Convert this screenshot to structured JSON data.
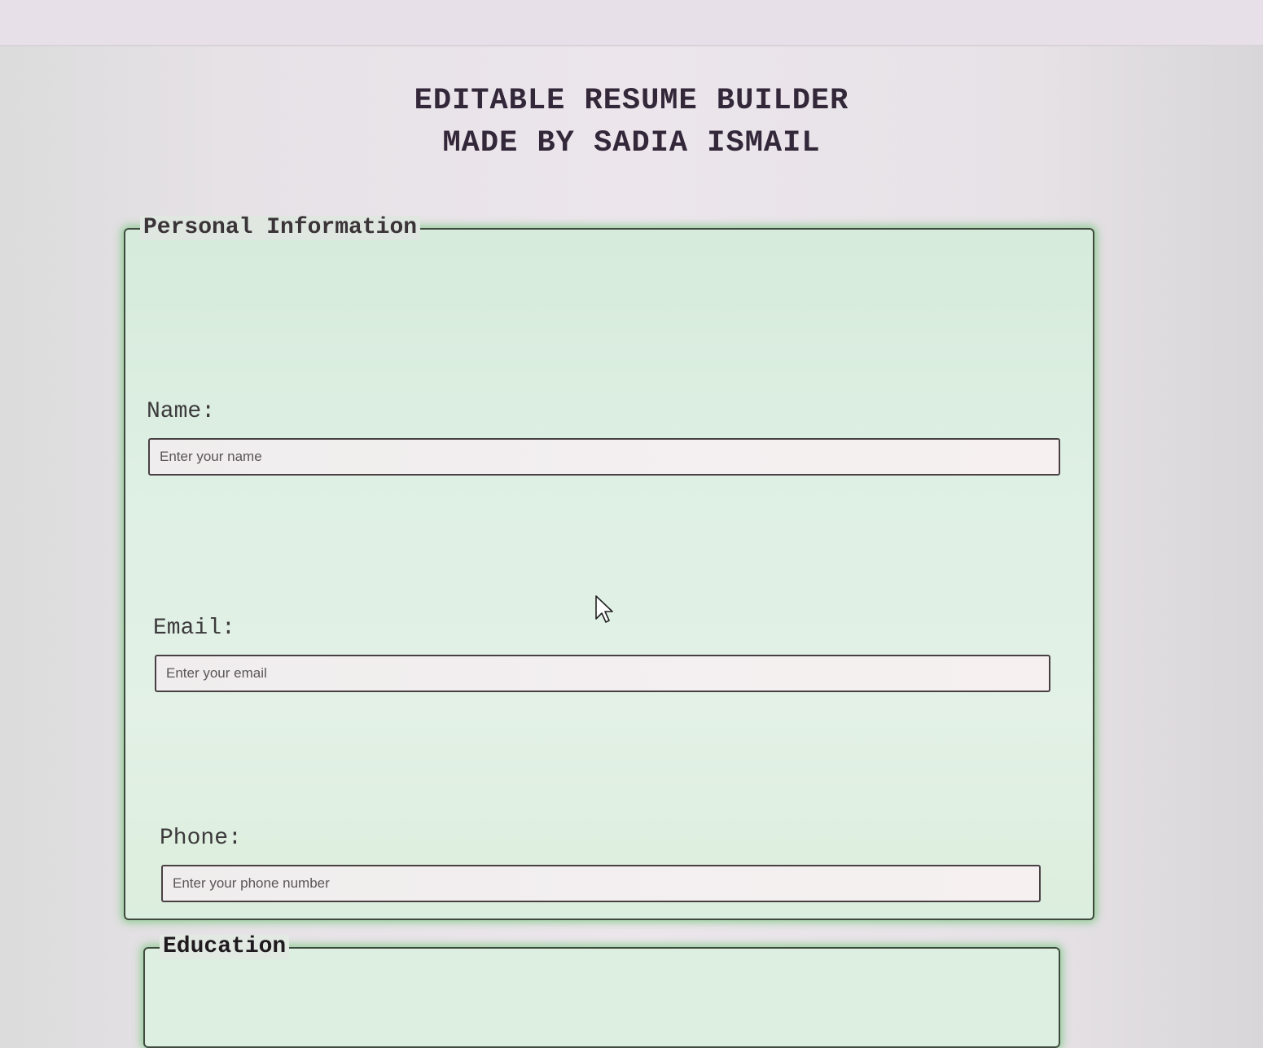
{
  "header": {
    "line1": "EDITABLE RESUME BUILDER",
    "line2": "MADE BY SADIA ISMAIL"
  },
  "personal": {
    "legend": "Personal Information",
    "name": {
      "label": "Name:",
      "placeholder": "Enter your name",
      "value": ""
    },
    "email": {
      "label": "Email:",
      "placeholder": "Enter your email",
      "value": ""
    },
    "phone": {
      "label": "Phone:",
      "placeholder": "Enter your phone number",
      "value": ""
    }
  },
  "education": {
    "legend": "Education"
  },
  "colors": {
    "section_bg": "#dcefe0",
    "section_glow": "#50be5a",
    "border": "#3e4a3e",
    "title_text": "#33283a"
  },
  "icons": {
    "pointer": "mouse-pointer-icon"
  }
}
